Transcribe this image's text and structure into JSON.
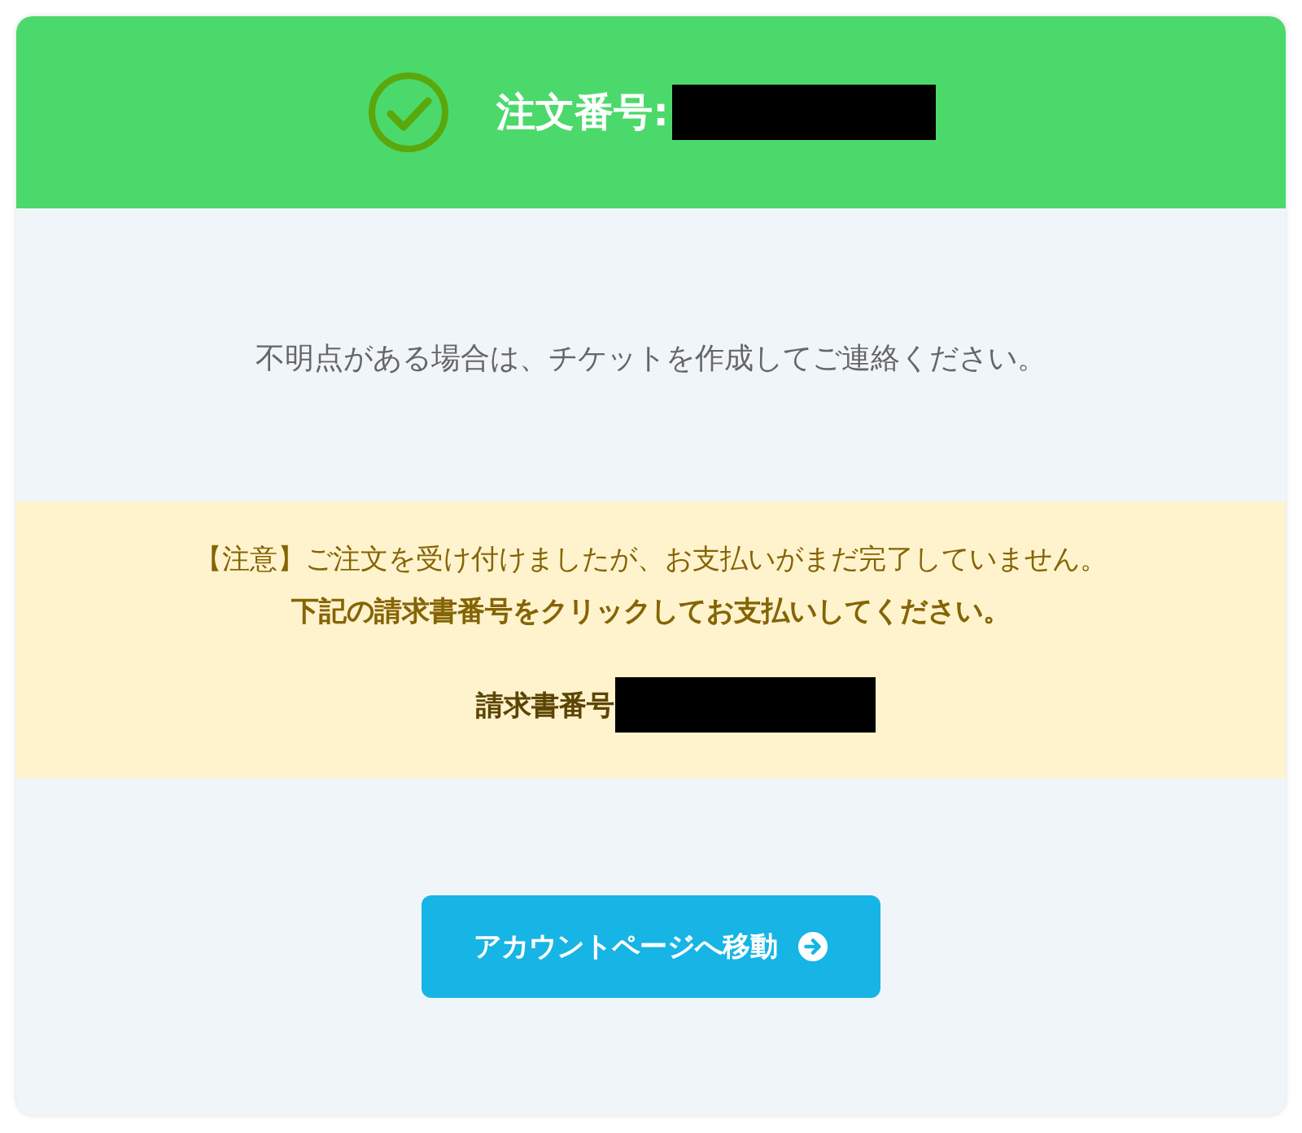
{
  "header": {
    "title": "注文番号:"
  },
  "message": "不明点がある場合は、チケットを作成してご連絡ください。",
  "notice": {
    "warning": "【注意】ご注文を受け付けましたが、お支払いがまだ完了していません。",
    "instruction": "下記の請求書番号をクリックしてお支払いしてください。",
    "invoice_label": "請求書番号"
  },
  "button": {
    "label": "アカウントページへ移動"
  }
}
